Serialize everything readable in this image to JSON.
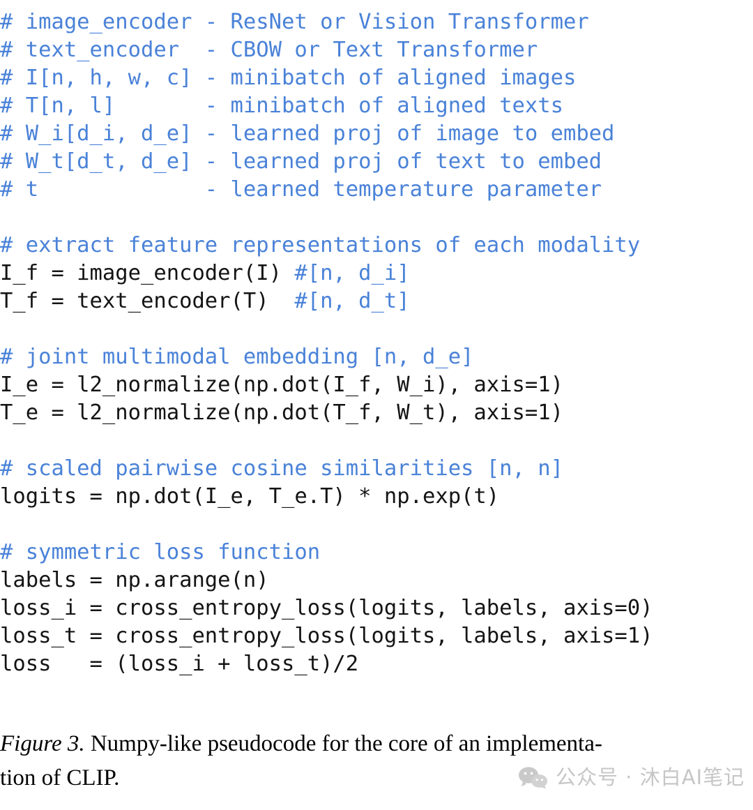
{
  "figure": {
    "background_color": "#ffffff",
    "comment_color": "#4a82d8",
    "code_color": "#141414",
    "caption_color": "#000000",
    "watermark_color": "#c6c6c6"
  },
  "code": {
    "language": "numpy-pseudocode",
    "lines": [
      {
        "type": "comment",
        "text": "# image_encoder - ResNet or Vision Transformer"
      },
      {
        "type": "comment",
        "text": "# text_encoder  - CBOW or Text Transformer"
      },
      {
        "type": "comment",
        "text": "# I[n, h, w, c] - minibatch of aligned images"
      },
      {
        "type": "comment",
        "text": "# T[n, l]       - minibatch of aligned texts"
      },
      {
        "type": "comment",
        "text": "# W_i[d_i, d_e] - learned proj of image to embed"
      },
      {
        "type": "comment",
        "text": "# W_t[d_t, d_e] - learned proj of text to embed"
      },
      {
        "type": "comment",
        "text": "# t             - learned temperature parameter"
      },
      {
        "type": "blank",
        "text": ""
      },
      {
        "type": "comment",
        "text": "# extract feature representations of each modality"
      },
      {
        "type": "mixed",
        "code": "I_f = image_encoder(I) ",
        "comment": "#[n, d_i]"
      },
      {
        "type": "mixed",
        "code": "T_f = text_encoder(T)  ",
        "comment": "#[n, d_t]"
      },
      {
        "type": "blank",
        "text": ""
      },
      {
        "type": "comment",
        "text": "# joint multimodal embedding [n, d_e]"
      },
      {
        "type": "code",
        "text": "I_e = l2_normalize(np.dot(I_f, W_i), axis=1)"
      },
      {
        "type": "code",
        "text": "T_e = l2_normalize(np.dot(T_f, W_t), axis=1)"
      },
      {
        "type": "blank",
        "text": ""
      },
      {
        "type": "comment",
        "text": "# scaled pairwise cosine similarities [n, n]"
      },
      {
        "type": "code",
        "text": "logits = np.dot(I_e, T_e.T) * np.exp(t)"
      },
      {
        "type": "blank",
        "text": ""
      },
      {
        "type": "comment",
        "text": "# symmetric loss function"
      },
      {
        "type": "code",
        "text": "labels = np.arange(n)"
      },
      {
        "type": "code",
        "text": "loss_i = cross_entropy_loss(logits, labels, axis=0)"
      },
      {
        "type": "code",
        "text": "loss_t = cross_entropy_loss(logits, labels, axis=1)"
      },
      {
        "type": "code",
        "text": "loss   = (loss_i + loss_t)/2"
      }
    ]
  },
  "caption": {
    "label": "Figure 3.",
    "line1_rest": " Numpy-like pseudocode for the core of an implementa-",
    "line2": "tion of CLIP.",
    "full_text": "Figure 3. Numpy-like pseudocode for the core of an implementation of CLIP."
  },
  "watermark": {
    "icon": "wechat-icon",
    "text": "公众号 · 沐白AI笔记"
  }
}
